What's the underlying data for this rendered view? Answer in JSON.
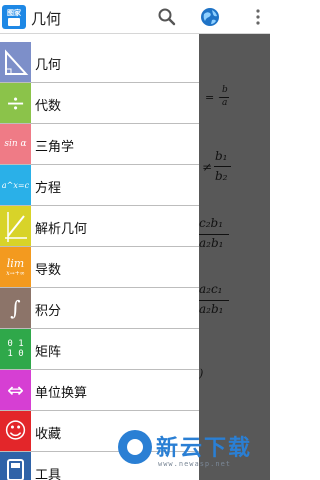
{
  "app": {
    "title": "几何",
    "logo_text": "图家",
    "icons": {
      "logo": "app-logo-icon",
      "search": "search-icon",
      "globe": "globe-icon",
      "menu": "overflow-menu-icon"
    },
    "colors": {
      "accent": "#1e88e5"
    }
  },
  "drawer": {
    "items": [
      {
        "label": "几何",
        "icon": "geometry-triangle-icon",
        "color": "#7d8fc9"
      },
      {
        "label": "代数",
        "icon": "algebra-divide-icon",
        "color": "#8bc34a",
        "tile_text": "÷"
      },
      {
        "label": "三角学",
        "icon": "trigonometry-icon",
        "color": "#ef7b86",
        "tile_text": "sin α"
      },
      {
        "label": "方程",
        "icon": "equation-icon",
        "color": "#2ab0e8",
        "tile_text": "a^x=c"
      },
      {
        "label": "解析几何",
        "icon": "analytic-geometry-icon",
        "color": "#d8d329"
      },
      {
        "label": "导数",
        "icon": "derivative-limit-icon",
        "color": "#f39a1f",
        "tile_text": "lim",
        "tile_sub": "x→+∞"
      },
      {
        "label": "积分",
        "icon": "integral-icon",
        "color": "#8c7469",
        "tile_text": "∫"
      },
      {
        "label": "矩阵",
        "icon": "matrix-icon",
        "color": "#2fa84a",
        "tile_text": "0 1",
        "tile_text2": "1 0"
      },
      {
        "label": "单位换算",
        "icon": "unit-conversion-icon",
        "color": "#d63fd3",
        "tile_text": "⇔"
      },
      {
        "label": "收藏",
        "icon": "favorites-smiley-icon",
        "color": "#e3262a",
        "tile_text": "☺"
      },
      {
        "label": "工具",
        "icon": "tools-icon",
        "color": "#2f63a8"
      }
    ]
  },
  "background_content": {
    "line1": "= −",
    "frac1_num": "b",
    "frac1_den": "a",
    "line2": "≠",
    "frac2_num": "b₁",
    "frac2_den": "b₂",
    "frac3_num": "c₂b₁",
    "frac3_den": "a₂b₁",
    "frac4_num": "a₂c₁",
    "frac4_den": "a₂b₁",
    "paren": ")"
  },
  "watermark": {
    "text": "新云下载",
    "url": "www.newasp.net"
  }
}
